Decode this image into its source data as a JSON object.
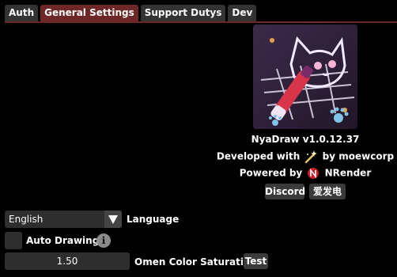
{
  "tabs": [
    {
      "label": "Auth",
      "active": false
    },
    {
      "label": "General Settings",
      "active": true
    },
    {
      "label": "Support Dutys",
      "active": false
    },
    {
      "label": "Dev",
      "active": false
    }
  ],
  "about": {
    "version": "NyaDraw v1.0.12.37",
    "developed_prefix": "Developed with",
    "developed_suffix": "by moewcorp",
    "powered_prefix": "Powered by",
    "powered_suffix": "NRender",
    "discord_label": "Discord",
    "afdian_label": "爱发电"
  },
  "settings": {
    "language_value": "English",
    "language_label": "Language",
    "auto_drawings_label": "Auto Drawings",
    "auto_drawings_checked": false,
    "info_glyph": "i",
    "saturation_value": "1.50",
    "saturation_label": "Omen Color Saturation",
    "test_label": "Test"
  },
  "icons": {
    "logo": "nyadraw-cat-logo",
    "wand": "magic-wand-icon",
    "nrender": "nrender-logo-icon",
    "dropdown": "triangle-down-icon",
    "info": "info-icon"
  },
  "colors": {
    "active_tab": "#6e2727",
    "tab": "#333333",
    "background": "#000000",
    "widget": "#2e2e2e"
  }
}
